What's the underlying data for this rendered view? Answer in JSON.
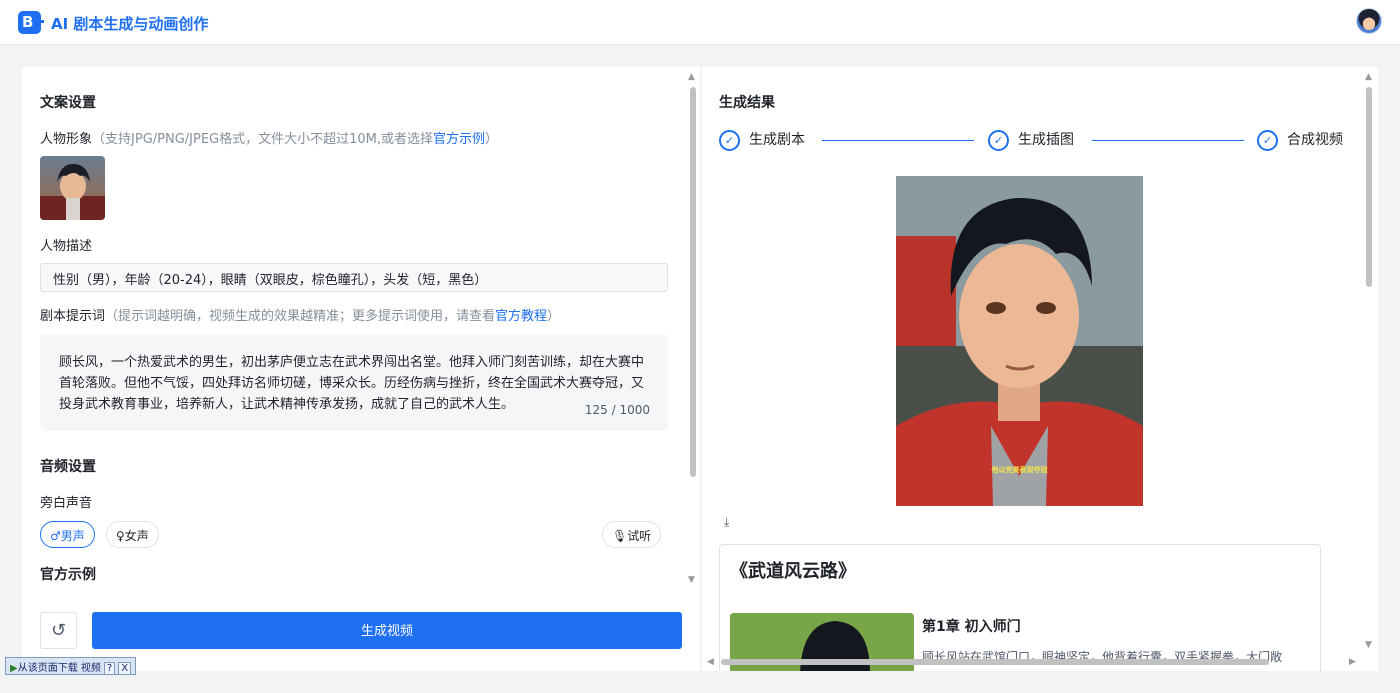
{
  "header": {
    "logo_letter": "B",
    "app_title": "AI 剧本生成与动画创作"
  },
  "left": {
    "copy_section_title": "文案设置",
    "character_label": "人物形象",
    "character_hint": "（支持JPG/PNG/JPEG格式，文件大小不超过10M,或者选择",
    "character_hint_link": "官方示例",
    "character_hint_end": "）",
    "desc_label": "人物描述",
    "desc_value": "性别（男），年龄（20-24），眼睛（双眼皮，棕色瞳孔），头发（短，黑色）",
    "prompt_label": "剧本提示词",
    "prompt_hint": "（提示词越明确，视频生成的效果越精准；更多提示词使用，请查看",
    "prompt_hint_link": "官方教程",
    "prompt_hint_end": "）",
    "prompt_text": "顾长风，一个热爱武术的男生，初出茅庐便立志在武术界闯出名堂。他拜入师门刻苦训练，却在大赛中首轮落败。但他不气馁，四处拜访名师切磋，博采众长。历经伤病与挫折，终在全国武术大赛夺冠，又投身武术教育事业，培养新人，让武术精神传承发扬，成就了自己的武术人生。",
    "prompt_count": "125 / 1000",
    "audio_section_title": "音频设置",
    "narration_label": "旁白声音",
    "voice_male": "男声",
    "voice_female": "女声",
    "listen": "试听",
    "examples_title": "官方示例",
    "generate_button": "生成视频"
  },
  "right": {
    "result_title": "生成结果",
    "steps": [
      "生成剧本",
      "生成插图",
      "合成视频"
    ],
    "image_caption": "他以完美表现夺冠",
    "story_title": "《武道风云路》",
    "chapter_title": "第1章 初入师门",
    "chapter_text": "顾长风站在武馆门口，眼神坚定，他背着行囊，双手紧握拳，大门敞"
  },
  "download_toolbar": {
    "label": "从该页面下载 视频",
    "help": "?",
    "close": "X"
  },
  "colors": {
    "accent": "#1f6ff2"
  }
}
